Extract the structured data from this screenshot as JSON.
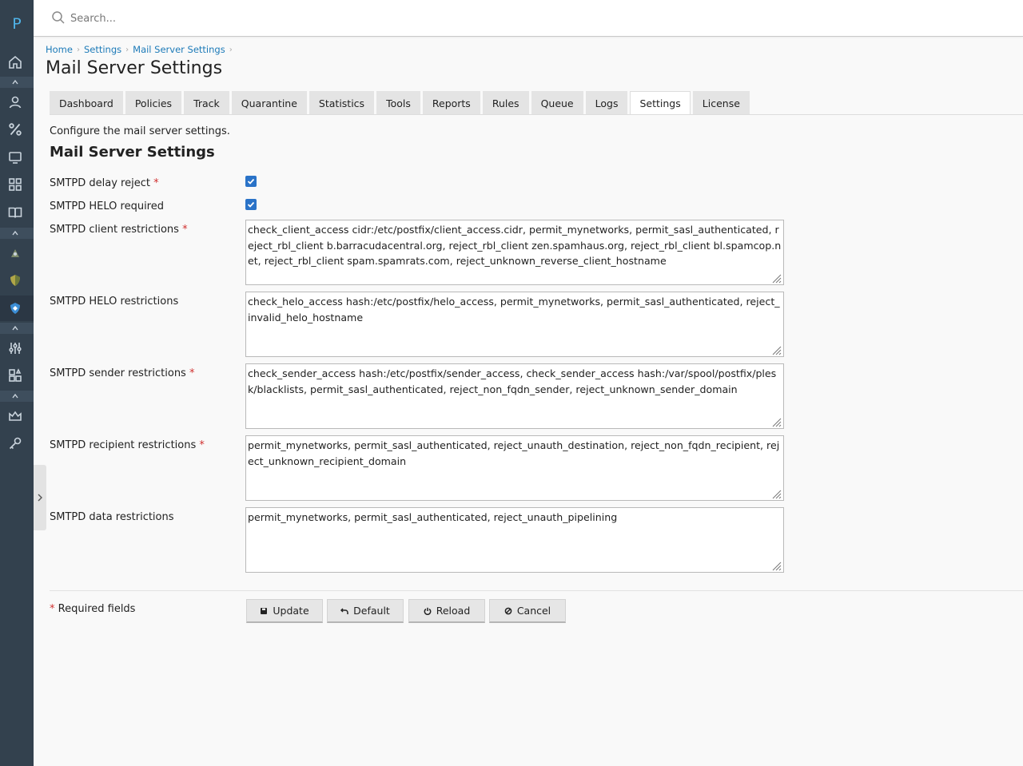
{
  "app": {
    "logo_letter": "P",
    "accent_color": "#2a73c8",
    "sidebar_color": "#33414e"
  },
  "sidebar": {
    "icons": [
      "home-icon",
      "user-icon",
      "percent-icon",
      "monitor-icon",
      "grid-icon",
      "book-icon",
      "rocket-icon",
      "shield-badge-icon",
      "shield-active-icon",
      "sliders-icon",
      "extensions-icon",
      "crown-icon",
      "key-icon"
    ],
    "active_item": "shield-active-icon"
  },
  "search": {
    "placeholder": "Search..."
  },
  "breadcrumb": {
    "items": [
      "Home",
      "Settings",
      "Mail Server Settings"
    ]
  },
  "page": {
    "title": "Mail Server Settings"
  },
  "tabs": [
    {
      "label": "Dashboard",
      "active": false
    },
    {
      "label": "Policies",
      "active": false
    },
    {
      "label": "Track",
      "active": false
    },
    {
      "label": "Quarantine",
      "active": false
    },
    {
      "label": "Statistics",
      "active": false
    },
    {
      "label": "Tools",
      "active": false
    },
    {
      "label": "Reports",
      "active": false
    },
    {
      "label": "Rules",
      "active": false
    },
    {
      "label": "Queue",
      "active": false
    },
    {
      "label": "Logs",
      "active": false
    },
    {
      "label": "Settings",
      "active": true
    },
    {
      "label": "License",
      "active": false
    }
  ],
  "form": {
    "intro": "Configure the mail server settings.",
    "section_title": "Mail Server Settings",
    "delay_reject": {
      "label": "SMTPD delay reject",
      "required": "*",
      "checked": true
    },
    "helo_required": {
      "label": "SMTPD HELO required",
      "checked": true
    },
    "client_restrictions": {
      "label": "SMTPD client restrictions",
      "required": "*",
      "value": "check_client_access cidr:/etc/postfix/client_access.cidr, permit_mynetworks, permit_sasl_authenticated, reject_rbl_client b.barracudacentral.org, reject_rbl_client zen.spamhaus.org, reject_rbl_client bl.spamcop.net, reject_rbl_client spam.spamrats.com, reject_unknown_reverse_client_hostname"
    },
    "helo_restrictions": {
      "label": "SMTPD HELO restrictions",
      "value": "check_helo_access hash:/etc/postfix/helo_access, permit_mynetworks, permit_sasl_authenticated, reject_invalid_helo_hostname"
    },
    "sender_restrictions": {
      "label": "SMTPD sender restrictions",
      "required": "*",
      "value": "check_sender_access hash:/etc/postfix/sender_access, check_sender_access hash:/var/spool/postfix/plesk/blacklists, permit_sasl_authenticated, reject_non_fqdn_sender, reject_unknown_sender_domain"
    },
    "recipient_restrictions": {
      "label": "SMTPD recipient restrictions",
      "required": "*",
      "value": "permit_mynetworks, permit_sasl_authenticated, reject_unauth_destination, reject_non_fqdn_recipient, reject_unknown_recipient_domain"
    },
    "data_restrictions": {
      "label": "SMTPD data restrictions",
      "value": "permit_mynetworks, permit_sasl_authenticated, reject_unauth_pipelining"
    },
    "required_note": {
      "mark": "*",
      "text": "Required fields"
    }
  },
  "buttons": {
    "update": "Update",
    "default": "Default",
    "reload": "Reload",
    "cancel": "Cancel"
  }
}
